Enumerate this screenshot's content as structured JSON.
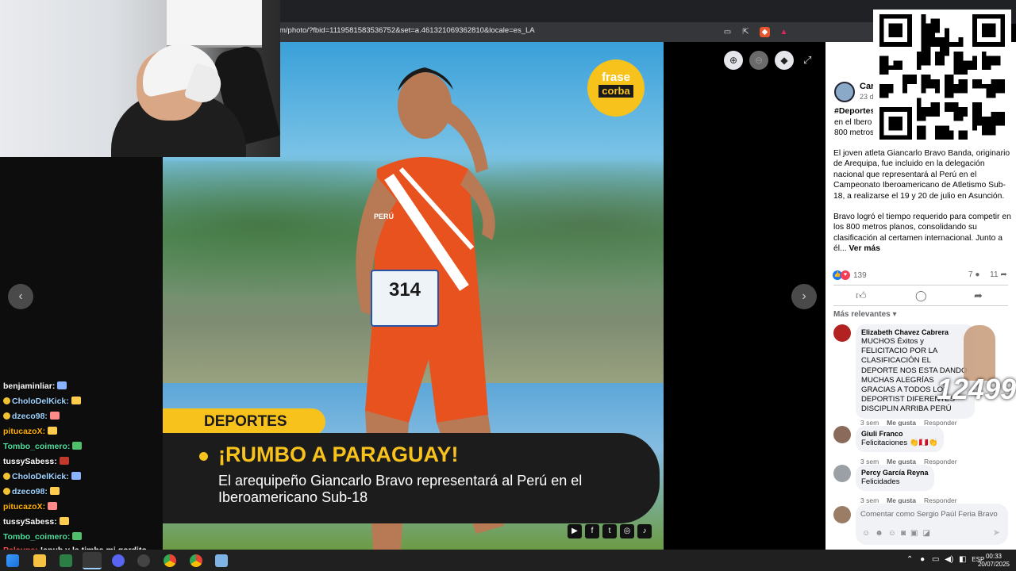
{
  "browser": {
    "url": "m/photo/?fbid=1119581583536752&set=a.461321069362810&locale=es_LA"
  },
  "photo": {
    "logo_line1": "frase",
    "logo_line2": "corba",
    "bib_number": "314",
    "jersey_text": "PERÚ",
    "section_tag": "DEPORTES",
    "headline": "¡RUMBO A PARAGUAY!",
    "subline": "El arequipeño Giancarlo Bravo representará al Perú en el Iberoamericano Sub-18"
  },
  "chat": {
    "messages": [
      {
        "user": "benjaminliar:",
        "color": "#ffffff",
        "badge": false
      },
      {
        "user": "CholoDelKick:",
        "color": "#9fd3ff",
        "badge": true
      },
      {
        "user": "dzeco98:",
        "color": "#9fd3ff",
        "badge": true
      },
      {
        "user": "pitucazoX:",
        "color": "#ffb000",
        "badge": false
      },
      {
        "user": "Tombo_coimero:",
        "color": "#4fe0a0",
        "badge": false
      },
      {
        "user": "tussySabess:",
        "color": "#ffffff",
        "badge": false
      },
      {
        "user": "CholoDelKick:",
        "color": "#9fd3ff",
        "badge": true
      },
      {
        "user": "dzeco98:",
        "color": "#9fd3ff",
        "badge": true
      },
      {
        "user": "pitucazoX:",
        "color": "#ffb000",
        "badge": false
      },
      {
        "user": "tussySabess:",
        "color": "#ffffff",
        "badge": false
      },
      {
        "user": "Tombo_coimero:",
        "color": "#4fe0a0",
        "badge": false
      }
    ],
    "last_user": "Pelaupe:",
    "last_text": "!anub y la timba mi gordito"
  },
  "post": {
    "page_name": "Car",
    "date": "23 d",
    "hashtag": "#Deportes",
    "intro": "en el Ibero 800 metros",
    "paragraph1": "El joven atleta Giancarlo Bravo Banda, originario de Arequipa, fue incluido en la delegación nacional que representará al Perú en el Campeonato Iberoamericano de Atletismo Sub-18, a realizarse el 19 y 20 de julio en Asunción.",
    "paragraph2": "Bravo logró el tiempo requerido para competir en los 800 metros planos, consolidando su clasificación al certamen internacional. Junto a él...",
    "see_more": "Ver más",
    "reactions_count": "139",
    "comments_count": "7",
    "shares_count": "11",
    "sort_label": "Más relevantes"
  },
  "comments": [
    {
      "author": "Elizabeth Chavez Cabrera",
      "text": "MUCHOS Éxitos y FELICITACIO POR LA CLASIFICACIÓN EL DEPORTE NOS ESTA DANDO MUCHAS ALEGRÍAS GRACIAS A TODOS LOS DEPORTIST DIFERENTES DISCIPLIN ARRIBA PERÚ",
      "time": "3 sem",
      "like": "Me gusta",
      "reply": "Responder",
      "avatar_color": "#b22222"
    },
    {
      "author": "Giuli Franco",
      "text": "Felicitaciones 👏🇵🇪👏",
      "time": "3 sem",
      "like": "Me gusta",
      "reply": "Responder",
      "avatar_color": "#8a6a5a"
    },
    {
      "author": "Percy García Reyna",
      "text": "Felicidades",
      "time": "3 sem",
      "like": "Me gusta",
      "reply": "Responder",
      "avatar_color": "#9aa0a6"
    }
  ],
  "composer": {
    "placeholder": "Comentar como Sergio Paúl Feria Bravo"
  },
  "overlay": {
    "number_text": "12499"
  },
  "taskbar": {
    "lang": "ESP",
    "time": "00:33",
    "date": "20/07/2025"
  }
}
